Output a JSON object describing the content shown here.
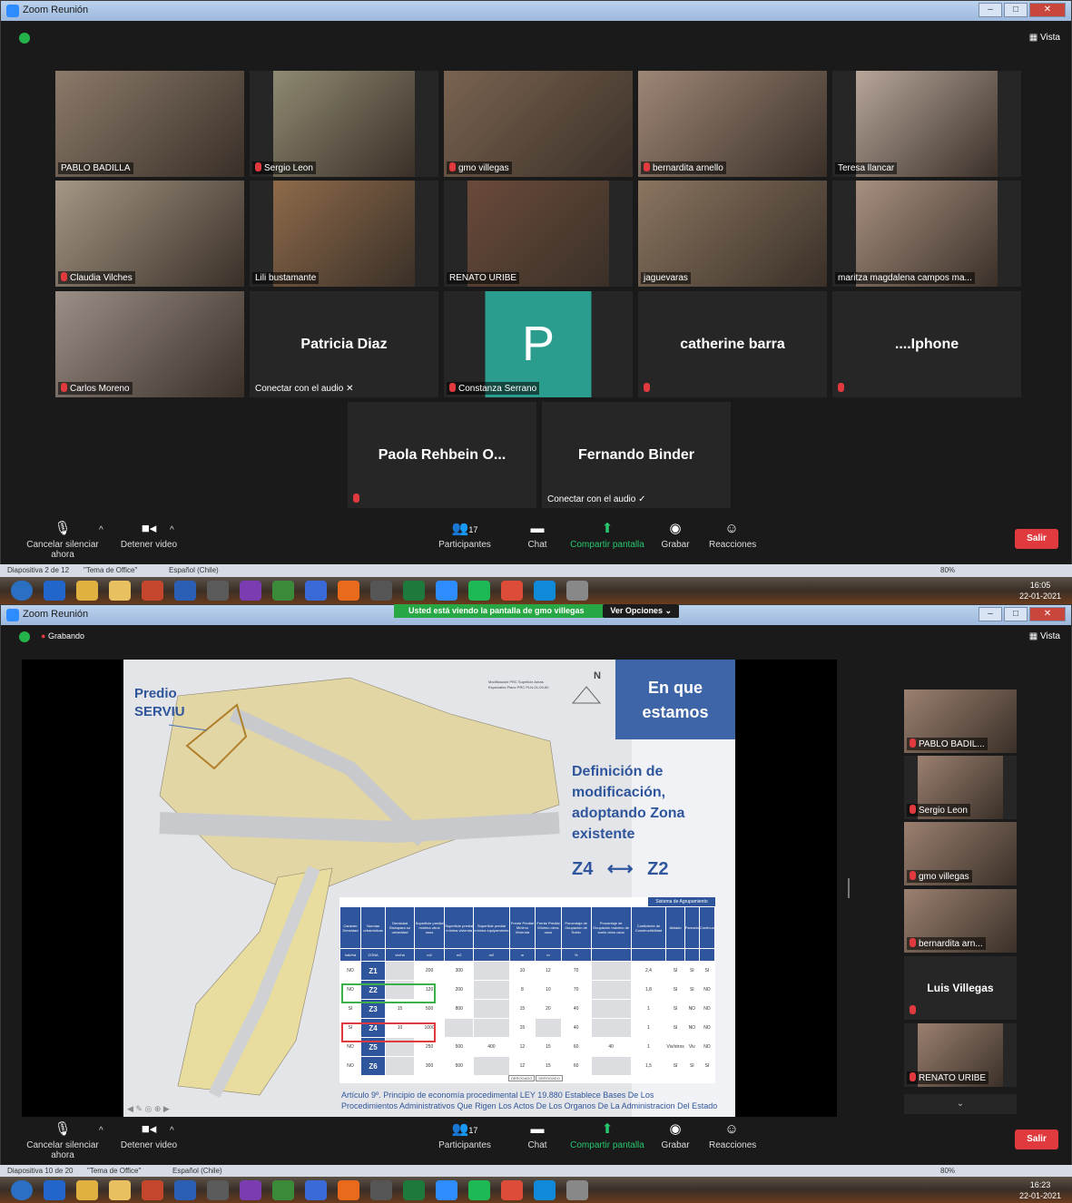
{
  "top": {
    "window_title": "Zoom Reunión",
    "view_label": "Vista",
    "participants": [
      {
        "name": "PABLO BADILLA",
        "muted": false,
        "kind": "video"
      },
      {
        "name": "Sergio Leon",
        "muted": true,
        "kind": "video"
      },
      {
        "name": "gmo villegas",
        "muted": true,
        "kind": "video"
      },
      {
        "name": "bernardita arnello",
        "muted": true,
        "kind": "video"
      },
      {
        "name": "Teresa llancar",
        "muted": false,
        "kind": "video"
      },
      {
        "name": "Claudia Vilches",
        "muted": true,
        "kind": "video"
      },
      {
        "name": "Lili bustamante",
        "muted": false,
        "kind": "video"
      },
      {
        "name": "RENATO URIBE",
        "muted": false,
        "kind": "video"
      },
      {
        "name": "jaguevaras",
        "muted": false,
        "kind": "video",
        "active": true
      },
      {
        "name": "maritza magdalena campos ma...",
        "muted": false,
        "kind": "video"
      },
      {
        "name": "Carlos Moreno",
        "muted": true,
        "kind": "video"
      },
      {
        "display": "Patricia Diaz",
        "status": "Conectar con el audio ✕",
        "kind": "name"
      },
      {
        "name": "Constanza Serrano",
        "letter": "P",
        "muted": true,
        "kind": "avatar"
      },
      {
        "display": "catherine barra",
        "muted": true,
        "kind": "name"
      },
      {
        "display": "....Iphone",
        "muted": true,
        "kind": "name"
      },
      {
        "display": "Paola Rehbein O...",
        "muted": true,
        "kind": "name"
      },
      {
        "display": "Fernando Binder",
        "status": "Conectar con el audio ✓",
        "kind": "name"
      }
    ],
    "controls": {
      "unmute": "Cancelar silenciar ahora",
      "video": "Detener video",
      "participants": "Participantes",
      "participant_count": "17",
      "chat": "Chat",
      "share": "Compartir pantalla",
      "record": "Grabar",
      "reactions": "Reacciones",
      "leave": "Salir"
    },
    "statusbar": {
      "slide": "Diapositiva 2 de 12",
      "theme": "\"Tema de Office\"",
      "lang": "Español (Chile)",
      "zoom": "80%"
    },
    "clock": {
      "time": "16:05",
      "date": "22-01-2021"
    }
  },
  "bottom": {
    "window_title": "Zoom Reunión",
    "recording": "Grabando",
    "view_label": "Vista",
    "share_banner": "Usted está viendo la pantalla de gmo villegas",
    "view_options": "Ver Opciones ⌄",
    "slide": {
      "predio_title": "Predio",
      "predio_sub": "SERVIU",
      "corner_title": "En que estamos",
      "north": "N",
      "definition": [
        "Definición de",
        "modificación,",
        "adoptando Zona",
        "existente"
      ],
      "zone_from": "Z4",
      "zone_to": "Z2",
      "table_group_header": "Sistema de Agrupamiento",
      "table_headers": [
        "Carácter Densidad",
        "Normas urbanísticas",
        "Densidad Brutapara su urbanidad",
        "Superficie predial mínima otros usos",
        "Superficie predial mínima vivienda",
        "Superficie predial mínima equipamiento",
        "Frente Predial Mínimo Vivienda",
        "Frente Predial Mínimo otros usos",
        "Porcentaje de Ocupación de Suelo",
        "Porcentaje de Ocupación máximo de suelo otros usos",
        "Coeficiente de Constructibilidad",
        "Aislado",
        "Pareado",
        "Continuo"
      ],
      "table_units": [
        "hab/há",
        "ZONA",
        "viv/há",
        "m2",
        "m2",
        "m2",
        "m",
        "m",
        "%",
        "",
        "",
        "",
        "",
        ""
      ],
      "table_rows": [
        [
          "NO",
          "Z1",
          "",
          "200",
          "300",
          "",
          "10",
          "12",
          "70",
          "",
          "2,4",
          "SI",
          "SI",
          "SI"
        ],
        [
          "NO",
          "Z2",
          "",
          "120",
          "200",
          "",
          "8",
          "10",
          "70",
          "",
          "1,8",
          "SI",
          "SI",
          "NO"
        ],
        [
          "SI",
          "Z3",
          "15",
          "500",
          "800",
          "",
          "15",
          "20",
          "40",
          "",
          "1",
          "SI",
          "NO",
          "NO"
        ],
        [
          "SI",
          "Z4",
          "10",
          "1000",
          "",
          "",
          "15",
          "",
          "40",
          "",
          "1",
          "SI",
          "NO",
          "NO"
        ],
        [
          "NO",
          "Z5",
          "",
          "250",
          "500",
          "400",
          "12",
          "15",
          "60",
          "40",
          "1",
          "Viv/otros",
          "Viv",
          "NO"
        ],
        [
          "NO",
          "Z6",
          "",
          "300",
          "500",
          "",
          "12",
          "15",
          "60",
          "",
          "1,5",
          "SI",
          "SI",
          "SI"
        ]
      ],
      "table_footer_labels": [
        "DEROGADO",
        "DEROGADO"
      ],
      "footnote_1": "Artículo 9º. Principio de economía procedimental LEY 19.880 Establece Bases De Los",
      "footnote_2": "Procedimientos Administrativos Que Rigen Los Actos De Los Organos De La Administracion Del Estado",
      "map_label_note": "Modificación PRC Supeficie Areas Especiales Plano PRC PLN-01-09-60"
    },
    "sidebar": [
      {
        "name": "PABLO BADIL...",
        "kind": "video"
      },
      {
        "name": "Sergio Leon",
        "kind": "video"
      },
      {
        "name": "gmo villegas",
        "kind": "video",
        "active": true
      },
      {
        "name": "bernardita arn...",
        "kind": "video"
      },
      {
        "display": "Luis Villegas",
        "kind": "name"
      },
      {
        "name": "RENATO URIBE",
        "kind": "video"
      }
    ],
    "controls": {
      "unmute": "Cancelar silenciar ahora",
      "video": "Detener video",
      "participants": "Participantes",
      "participant_count": "17",
      "chat": "Chat",
      "share": "Compartir pantalla",
      "record": "Grabar",
      "reactions": "Reacciones",
      "leave": "Salir"
    },
    "statusbar": {
      "slide": "Diapositiva 10 de 20",
      "theme": "\"Tema de Office\"",
      "lang": "Español (Chile)",
      "zoom": "80%"
    },
    "clock": {
      "time": "16:23",
      "date": "22-01-2021"
    }
  },
  "colors": {
    "accent": "#2d8cff",
    "leave": "#e0393e",
    "share": "#28a745",
    "active_speaker": "#c8e05a",
    "slide_blue": "#3d65a8",
    "zoom_box": "#2a9d8f"
  }
}
